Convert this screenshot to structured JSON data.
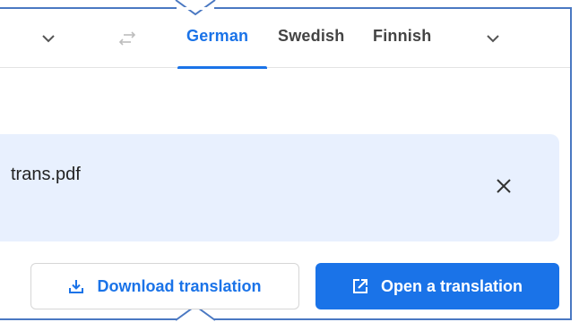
{
  "colors": {
    "accent": "#1a73e8",
    "card_background": "#e8f0fe",
    "frame": "#4a78c2"
  },
  "language_bar": {
    "source_dropdown_icon": "chevron-down-icon",
    "swap_icon": "swap-arrows-icon",
    "target_dropdown_icon": "chevron-down-icon",
    "tabs": [
      {
        "label": "German",
        "selected": true
      },
      {
        "label": "Swedish",
        "selected": false
      },
      {
        "label": "Finnish",
        "selected": false
      }
    ]
  },
  "file_card": {
    "file_name": "trans.pdf",
    "close_icon": "close-icon"
  },
  "actions": {
    "download_label": "Download translation",
    "download_icon": "download-icon",
    "open_label": "Open a translation",
    "open_icon": "open-external-icon"
  }
}
